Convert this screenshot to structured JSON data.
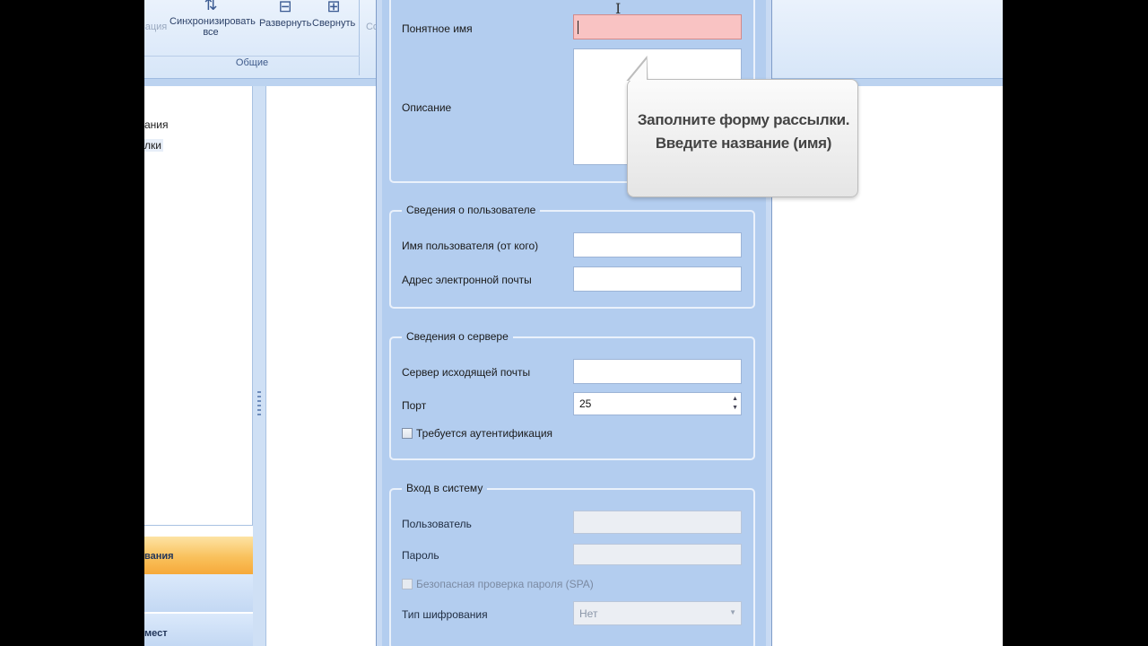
{
  "ribbon": {
    "btn_truncated": "ация",
    "btn_sync": "Синхронизировать все",
    "btn_sync_line1": "Синхронизировать",
    "btn_sync_line2": "все",
    "btn_expand": "Развернуть",
    "btn_collapse": "Свернуть",
    "btn_faded": "Со",
    "group_label": "Общие"
  },
  "nav": {
    "tree_items": [
      "ания",
      "лки"
    ],
    "buttons": [
      "вания",
      "",
      "мест"
    ]
  },
  "dialog": {
    "friendly_name_label": "Понятное имя",
    "friendly_name_value": "",
    "description_label": "Описание",
    "description_value": "",
    "user_group": {
      "title": "Сведения о пользователе",
      "username_label": "Имя пользователя (от кого)",
      "username_value": "",
      "email_label": "Адрес электронной почты",
      "email_value": ""
    },
    "server_group": {
      "title": "Сведения о сервере",
      "smtp_label": "Сервер исходящей почты",
      "smtp_value": "",
      "port_label": "Порт",
      "port_value": "25",
      "auth_label": "Требуется аутентификация",
      "auth_checked": false
    },
    "login_group": {
      "title": "Вход в систему",
      "user_label": "Пользователь",
      "user_value": "",
      "password_label": "Пароль",
      "password_value": "",
      "spa_label": "Безопасная проверка пароля (SPA)",
      "spa_checked": false,
      "encryption_label": "Тип шифрования",
      "encryption_value": "Нет"
    }
  },
  "callout": {
    "line1": "Заполните форму рассылки.",
    "line2": "Введите название (имя)"
  },
  "colors": {
    "dialog_bg": "#b3cdef",
    "active_field": "#f9c3c3",
    "nav_active": "#f9c15c"
  }
}
